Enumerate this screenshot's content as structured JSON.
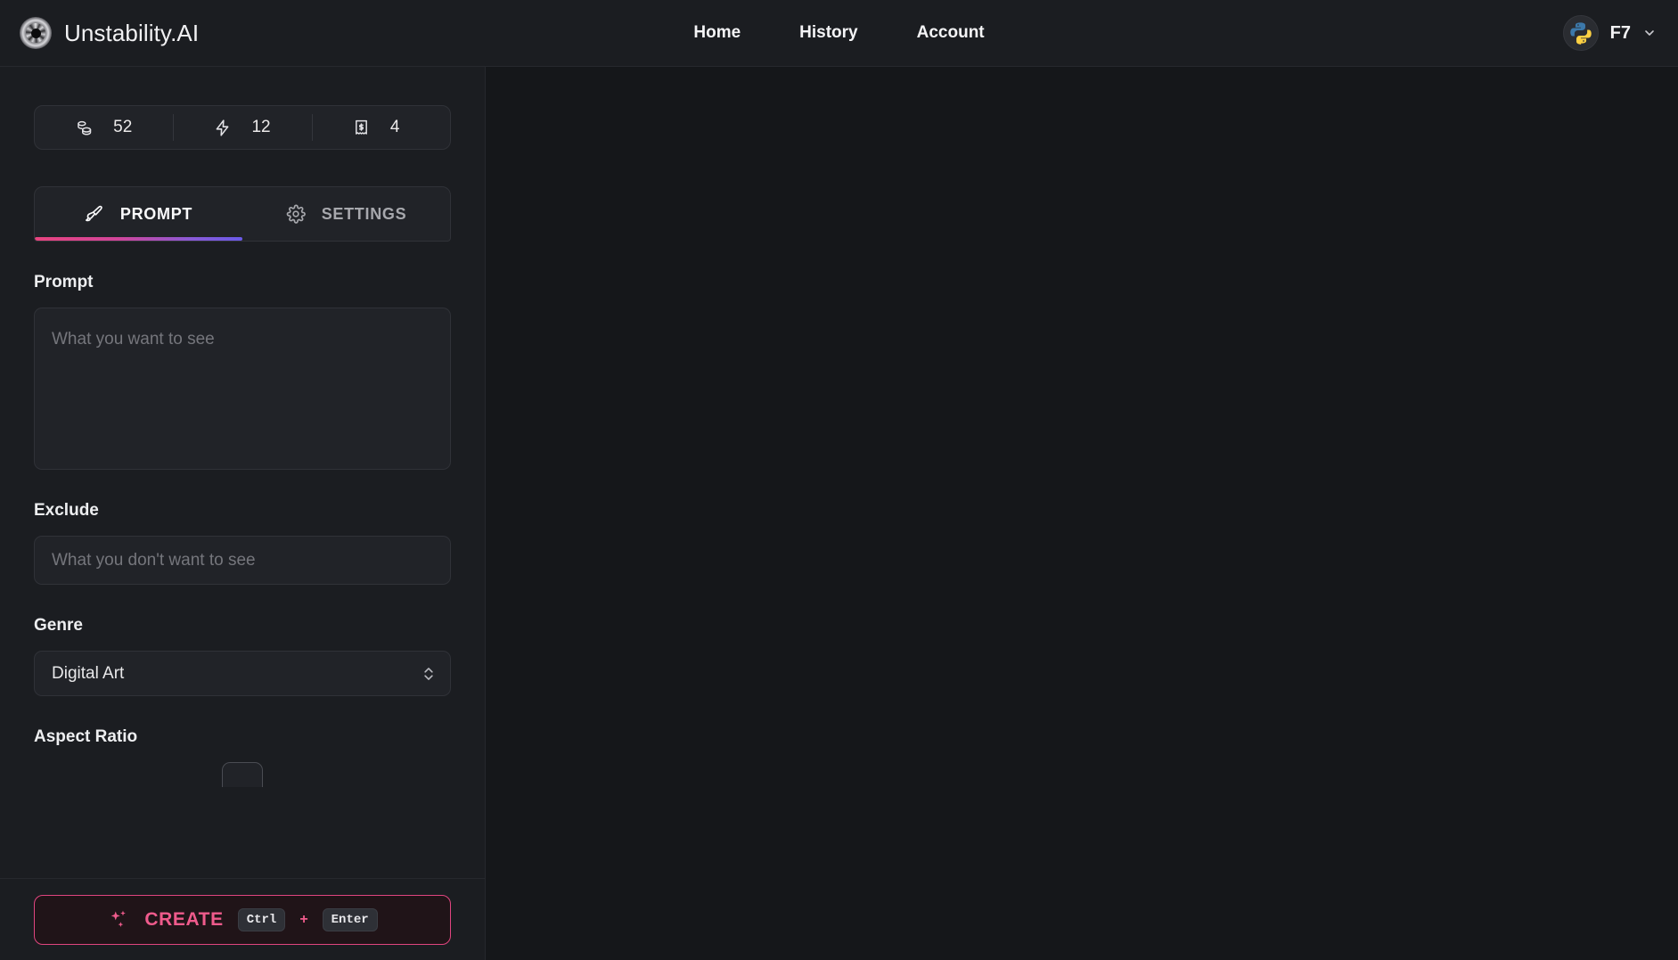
{
  "header": {
    "brand": "Unstability.AI",
    "logo_icon": "spiral-shutter-logo",
    "nav": [
      {
        "label": "Home"
      },
      {
        "label": "History"
      },
      {
        "label": "Account"
      }
    ],
    "user": {
      "name": "F7",
      "avatar_icon": "python-logo-avatar",
      "caret_icon": "chevron-down-icon"
    }
  },
  "sidebar": {
    "stats": [
      {
        "icon": "coins-stack-icon",
        "value": "52"
      },
      {
        "icon": "lightning-bolt-icon",
        "value": "12"
      },
      {
        "icon": "receipt-dollar-icon",
        "value": "4"
      }
    ],
    "tabs": [
      {
        "label": "PROMPT",
        "icon": "paintbrush-icon",
        "active": true
      },
      {
        "label": "SETTINGS",
        "icon": "gear-icon",
        "active": false
      }
    ],
    "fields": {
      "prompt": {
        "label": "Prompt",
        "placeholder": "What you want to see",
        "value": ""
      },
      "exclude": {
        "label": "Exclude",
        "placeholder": "What you don't want to see",
        "value": ""
      },
      "genre": {
        "label": "Genre",
        "value": "Digital Art",
        "options": [
          "Digital Art"
        ],
        "arrows_icon": "chevron-up-down-icon"
      },
      "aspect_ratio": {
        "label": "Aspect Ratio"
      }
    },
    "create": {
      "label": "CREATE",
      "icon": "sparkles-icon",
      "key_primary": "Ctrl",
      "key_plus": "+",
      "key_secondary": "Enter"
    }
  },
  "colors": {
    "accent_pink": "#ef5b8c",
    "accent_purple": "#6a5ae8",
    "background": "#15171a",
    "panel": "#1b1d21",
    "input": "#212328",
    "border": "#303238"
  }
}
